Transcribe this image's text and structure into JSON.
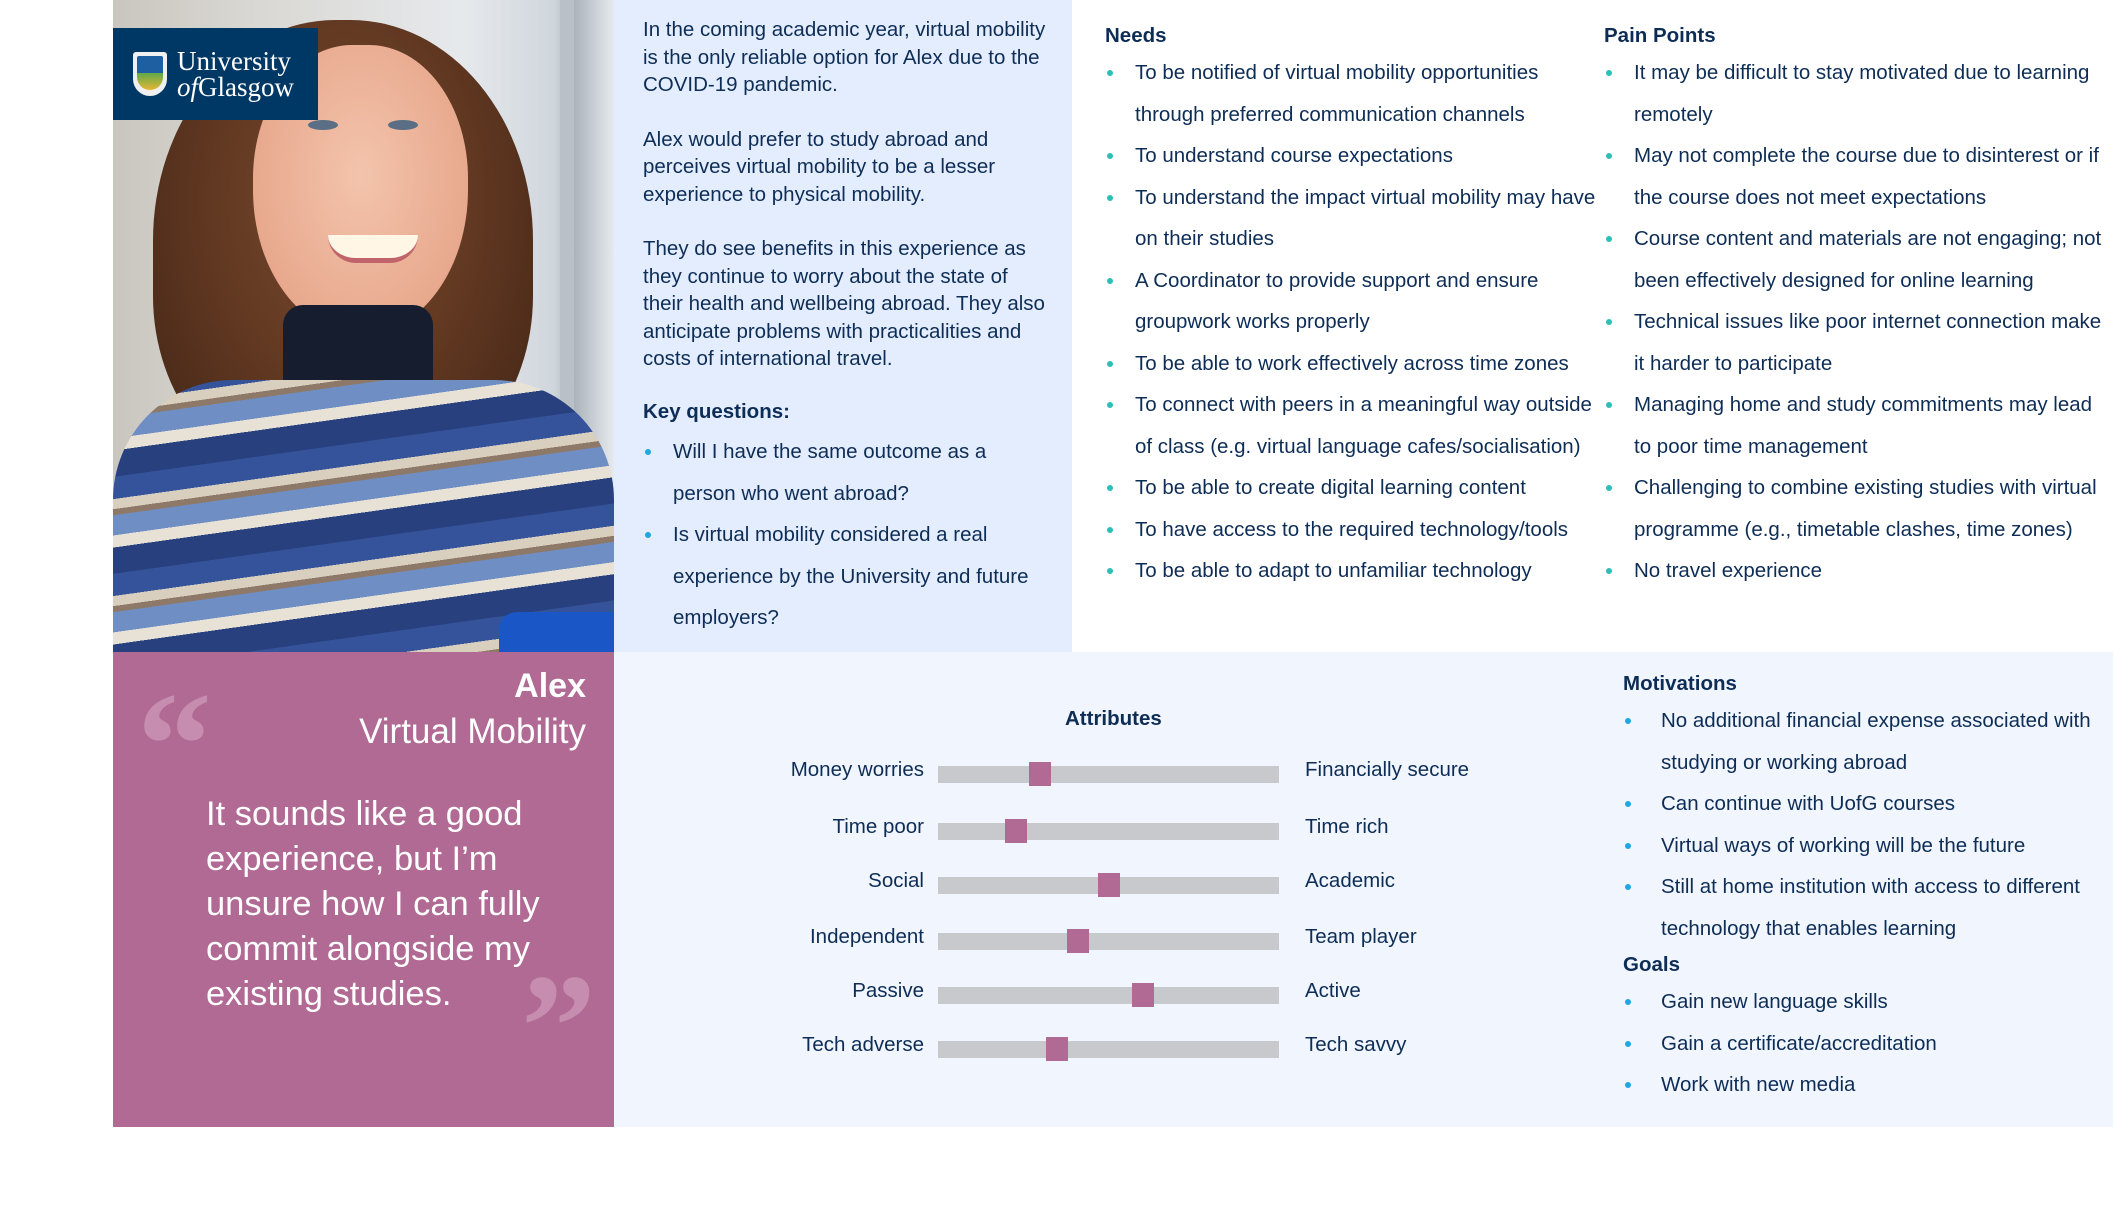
{
  "logo": {
    "line1": "University",
    "line2_prefix": "of",
    "line2": "Glasgow"
  },
  "intro": {
    "paragraphs": [
      "In the coming academic year, virtual mobility is the only reliable option for Alex due to the COVID-19 pandemic.",
      "Alex would prefer to study abroad and perceives virtual mobility to be a lesser experience to physical mobility.",
      "They do see benefits in this experience as they continue to worry about the state of their health and wellbeing abroad. They also anticipate problems with practicalities and costs of international travel."
    ],
    "key_questions_heading": "Key questions:",
    "key_questions": [
      "Will I have the same outcome as a person who went abroad?",
      "Is virtual mobility considered a real experience by the University and future employers?"
    ]
  },
  "needs": {
    "heading": "Needs",
    "items": [
      "To be notified of virtual mobility opportunities through preferred communication channels",
      "To understand course expectations",
      "To understand the impact virtual mobility may have on their studies",
      "A Coordinator to provide support and ensure groupwork works properly",
      "To be able to work effectively across time zones",
      "To connect with peers in a meaningful way outside of class (e.g. virtual language cafes/socialisation)",
      "To be able to create digital learning content",
      "To have access to the required technology/tools",
      "To be able to adapt to unfamiliar technology"
    ]
  },
  "pain_points": {
    "heading": "Pain Points",
    "items": [
      "It may be difficult to stay motivated due to learning remotely",
      "May not complete the course due to disinterest or if the course does not meet expectations",
      "Course content and materials are not engaging; not been effectively designed for online learning",
      "Technical issues like poor internet connection make it harder to participate",
      "Managing home and study commitments may lead to poor time management",
      "Challenging to combine existing studies with virtual programme (e.g., timetable clashes, time zones)",
      "No travel experience"
    ]
  },
  "persona": {
    "name": "Alex",
    "role": "Virtual Mobility",
    "quote": "It sounds like a good experience, but I’m unsure how I can fully commit alongside my existing studies.",
    "open_quote": "“",
    "close_quote": "”"
  },
  "attributes": {
    "title": "Attributes",
    "rows": [
      {
        "left": "Money worries",
        "right": "Financially secure",
        "value": 0.3
      },
      {
        "left": "Time poor",
        "right": "Time rich",
        "value": 0.23
      },
      {
        "left": "Social",
        "right": "Academic",
        "value": 0.5
      },
      {
        "left": "Independent",
        "right": "Team player",
        "value": 0.41
      },
      {
        "left": "Passive",
        "right": "Active",
        "value": 0.6
      },
      {
        "left": "Tech adverse",
        "right": "Tech savvy",
        "value": 0.35
      }
    ]
  },
  "motivations": {
    "heading": "Motivations",
    "items": [
      "No additional financial expense associated with studying or working abroad",
      "Can continue with UofG courses",
      "Virtual ways of working will be the future",
      "Still at home institution with access to different technology that enables learning"
    ]
  },
  "goals": {
    "heading": "Goals",
    "items": [
      "Gain new language skills",
      "Gain a certificate/accreditation",
      "Work with new media"
    ]
  },
  "colors": {
    "navy": "#003865",
    "text": "#0e2d56",
    "accent_purple": "#b06a94",
    "teal_bullet": "#2bbfb8",
    "blue_bullet": "#1ea7e0",
    "track_grey": "#c8c9cc"
  }
}
